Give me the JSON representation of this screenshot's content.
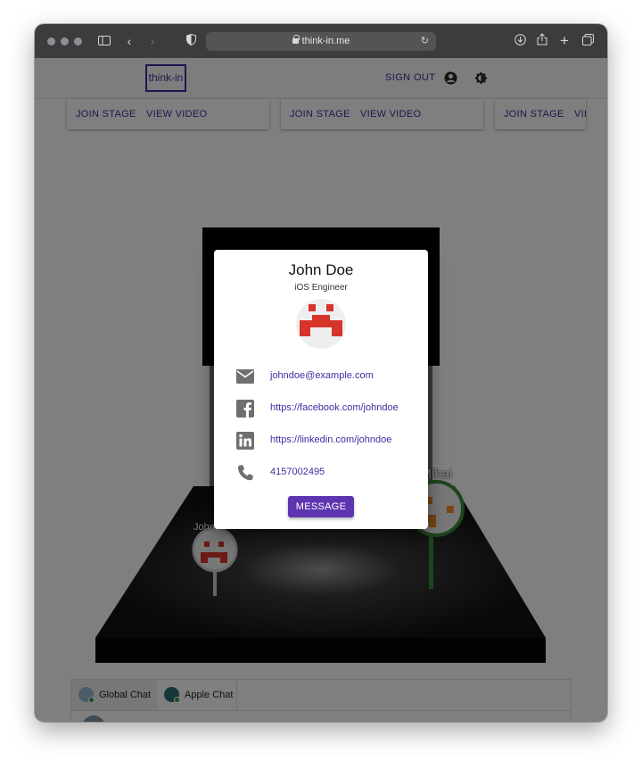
{
  "browser": {
    "url": "think-in.me"
  },
  "header": {
    "logo_text": "think-in",
    "signout_label": "SIGN OUT"
  },
  "stage_cards": [
    {
      "join_label": "JOIN STAGE",
      "video_label": "VIEW VIDEO"
    },
    {
      "join_label": "JOIN STAGE",
      "video_label": "VIEW VIDEO"
    },
    {
      "join_label": "JOIN STAGE",
      "video_label": "VIE"
    }
  ],
  "scene": {
    "avatar_left_label": "John",
    "avatar_right_label": "n Mihai"
  },
  "chat": {
    "tabs": [
      {
        "label": "Global Chat",
        "color": "#9bb7cc"
      },
      {
        "label": "Apple Chat",
        "color": "#2d6e73"
      }
    ]
  },
  "profile": {
    "name": "John Doe",
    "title": "iOS Engineer",
    "email": "johndoe@example.com",
    "facebook": "https://facebook.com/johndoe",
    "linkedin": "https://linkedin.com/johndoe",
    "phone": "4157002495",
    "message_label": "MESSAGE"
  },
  "colors": {
    "accent": "#3c2fa0",
    "button": "#5e35b1",
    "avatar_red": "#d6342b"
  }
}
